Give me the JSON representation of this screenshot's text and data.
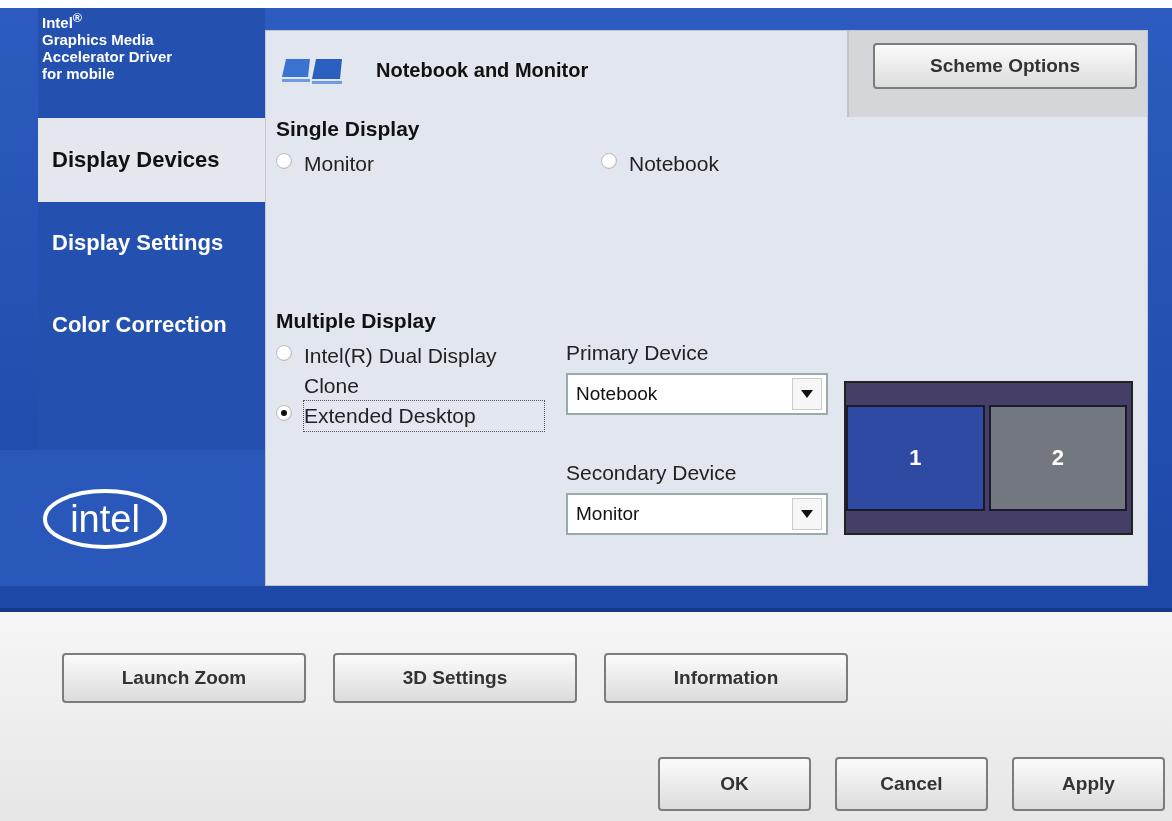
{
  "sidebar": {
    "title_lines": [
      "Intel$^{®}$",
      "Graphics Media",
      "Accelerator Driver",
      "for mobile"
    ],
    "items": [
      {
        "label": "Display Devices",
        "selected": true
      },
      {
        "label": "Display Settings",
        "selected": false
      },
      {
        "label": "Color Correction",
        "selected": false
      }
    ],
    "logo": "intel"
  },
  "panel": {
    "title": "Notebook and Monitor",
    "scheme_button": "Scheme Options",
    "single_display": {
      "heading": "Single Display",
      "options": [
        {
          "label": "Monitor",
          "selected": false
        },
        {
          "label": "Notebook",
          "selected": false
        }
      ]
    },
    "multiple_display": {
      "heading": "Multiple Display",
      "options": [
        {
          "label": "Intel(R) Dual Display Clone",
          "selected": false
        },
        {
          "label": "Extended Desktop",
          "selected": true
        }
      ]
    },
    "primary_device": {
      "label": "Primary Device",
      "value": "Notebook"
    },
    "secondary_device": {
      "label": "Secondary Device",
      "value": "Monitor"
    },
    "displays": [
      {
        "label": "1",
        "selected": true
      },
      {
        "label": "2",
        "selected": false
      }
    ]
  },
  "bottom_buttons": [
    "Launch Zoom",
    "3D Settings",
    "Information"
  ],
  "dialog_buttons": [
    "OK",
    "Cancel",
    "Apply"
  ]
}
